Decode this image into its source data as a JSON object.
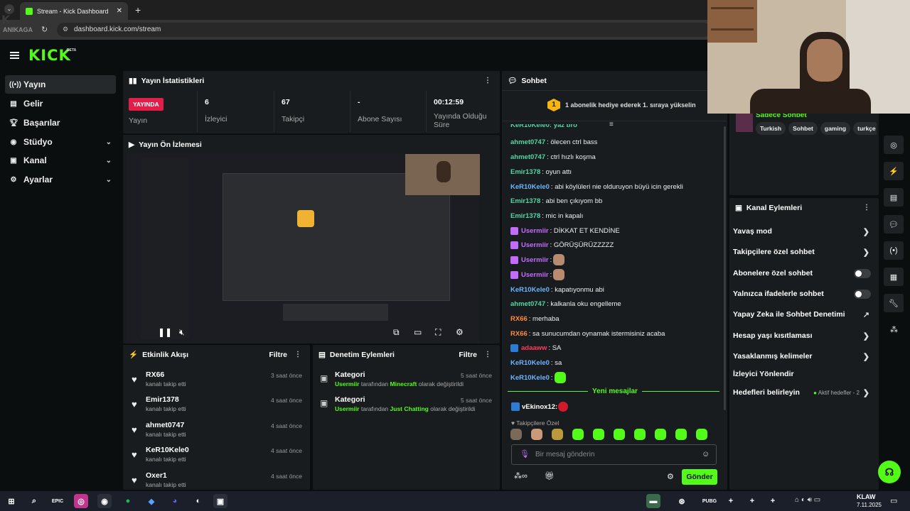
{
  "browser": {
    "tab_title": "Stream - Kick Dashboard",
    "url": "dashboard.kick.com/stream",
    "watermark_top": "K",
    "watermark_bottom": "ANIKAGA"
  },
  "brand": {
    "logo": "KICK",
    "beta": "BETA",
    "accent": "#53fc18"
  },
  "sidebar": {
    "items": [
      {
        "label": "Yayın",
        "icon": "broadcast-icon"
      },
      {
        "label": "Gelir",
        "icon": "wallet-icon"
      },
      {
        "label": "Başarılar",
        "icon": "trophy-icon"
      },
      {
        "label": "Stüdyo",
        "icon": "studio-icon"
      },
      {
        "label": "Kanal",
        "icon": "channel-icon"
      },
      {
        "label": "Ayarlar",
        "icon": "gear-icon"
      }
    ]
  },
  "stats": {
    "title": "Yayın İstatistikleri",
    "live_badge": "YAYINDA",
    "live_label": "Yayın",
    "viewers_value": "6",
    "viewers_label": "İzleyici",
    "followers_value": "67",
    "followers_label": "Takipçi",
    "subs_value": "-",
    "subs_label": "Abone Sayısı",
    "uptime_value": "00:12:59",
    "uptime_label1": "Yayında Olduğu",
    "uptime_label2": "Süre"
  },
  "preview": {
    "title": "Yayın Ön İzlemesi"
  },
  "activity": {
    "title": "Etkinlik Akışı",
    "filter": "Filtre",
    "items": [
      {
        "name": "RX66",
        "action": "kanalı takip etti",
        "time": "3 saat önce"
      },
      {
        "name": "Emir1378",
        "action": "kanalı takip etti",
        "time": "4 saat önce"
      },
      {
        "name": "ahmet0747",
        "action": "kanalı takip etti",
        "time": "4 saat önce"
      },
      {
        "name": "KeR10Kele0",
        "action": "kanalı takip etti",
        "time": "4 saat önce"
      },
      {
        "name": "Oxer1",
        "action": "kanalı takip etti",
        "time": "4 saat önce"
      }
    ]
  },
  "moderation": {
    "title": "Denetim Eylemleri",
    "filter": "Filtre",
    "items": [
      {
        "title": "Kategori",
        "user": "Usermiir",
        "mid": "tarafından",
        "category": "Minecraft",
        "tail": "olarak değiştirildi",
        "time": "5 saat önce"
      },
      {
        "title": "Kategori",
        "user": "Usermiir",
        "mid": "tarafından",
        "category": "Just Chatting",
        "tail": "olarak değiştirildi",
        "time": "5 saat önce"
      }
    ]
  },
  "chat": {
    "title": "Sohbet",
    "gift_rank": "1",
    "gift_text": "1 abonelik hediye ederek 1. sıraya yükselin",
    "messages": [
      {
        "user": "ahmet0747",
        "color": "#53d6a6",
        "text": ": ölecen ctrl bass"
      },
      {
        "user": "ahmet0747",
        "color": "#53d6a6",
        "text": ": ctrl hızlı koşma"
      },
      {
        "user": "Emir1378",
        "color": "#53d6a6",
        "text": ": oyun attı"
      },
      {
        "user": "KeR10Kele0",
        "color": "#6cb4ff",
        "text": ": abi köylüleri nie olduruyon büyü icin gerekli"
      },
      {
        "user": "Emir1378",
        "color": "#53d6a6",
        "text": ": abi ben çıkıyom bb"
      },
      {
        "user": "Emir1378",
        "color": "#53d6a6",
        "text": ": mic in kapalı"
      },
      {
        "user": "Usermiir",
        "color": "#c36bff",
        "text": ": DİKKAT ET KENDİNE"
      },
      {
        "user": "Usermiir",
        "color": "#c36bff",
        "text": ": GÖRÜŞÜRÜZZZZZ"
      },
      {
        "user": "Usermiir",
        "color": "#c36bff",
        "text": ":"
      },
      {
        "user": "Usermiir",
        "color": "#c36bff",
        "text": ":"
      },
      {
        "user": "KeR10Kele0",
        "color": "#6cb4ff",
        "text": ": kapatıyonmu abi"
      },
      {
        "user": "ahmet0747",
        "color": "#53d6a6",
        "text": ": kalkanla oku engelleme"
      },
      {
        "user": "RX66",
        "color": "#ff8a3d",
        "text": ": merhaba"
      },
      {
        "user": "RX66",
        "color": "#ff8a3d",
        "text": ": sa sunucumdan oynamak istermisiniz acaba"
      },
      {
        "user": "adaaww",
        "color": "#ff3b5c",
        "text": ": SA"
      },
      {
        "user": "KeR10Kele0",
        "color": "#6cb4ff",
        "text": ": sa"
      },
      {
        "user": "KeR10Kele0",
        "color": "#6cb4ff",
        "text": ":"
      }
    ],
    "new_messages": "Yeni mesajlar",
    "last_user": "vEkinox12:",
    "followers_only": "Takipçilere Özel",
    "input_placeholder": "Bir mesaj gönderin",
    "send": "Gönder"
  },
  "channel_actions": {
    "title": "Kanal Eylemleri",
    "category_line": "Sadece Sohbet",
    "tags": [
      "Turkish",
      "Sohbet",
      "gaming",
      "turkçe"
    ],
    "items": [
      {
        "label": "Yavaş mod",
        "kind": "chevron"
      },
      {
        "label": "Takipçilere özel sohbet",
        "kind": "chevron"
      },
      {
        "label": "Abonelere özel sohbet",
        "kind": "toggle"
      },
      {
        "label": "Yalnızca ifadelerle sohbet",
        "kind": "toggle"
      },
      {
        "label": "Yapay Zeka ile Sohbet Denetimi",
        "kind": "external"
      },
      {
        "label": "Hesap yaşı kısıtlaması",
        "kind": "chevron"
      },
      {
        "label": "Yasaklanmış kelimeler",
        "kind": "chevron"
      },
      {
        "label": "İzleyici Yönlendir",
        "kind": "none"
      },
      {
        "label": "Hedefleri belirleyin",
        "kind": "chevron"
      }
    ],
    "goals_status": "Aktif hedefler - 2"
  },
  "taskbar": {
    "lang": "KLAW",
    "date": "7.11.2025"
  }
}
